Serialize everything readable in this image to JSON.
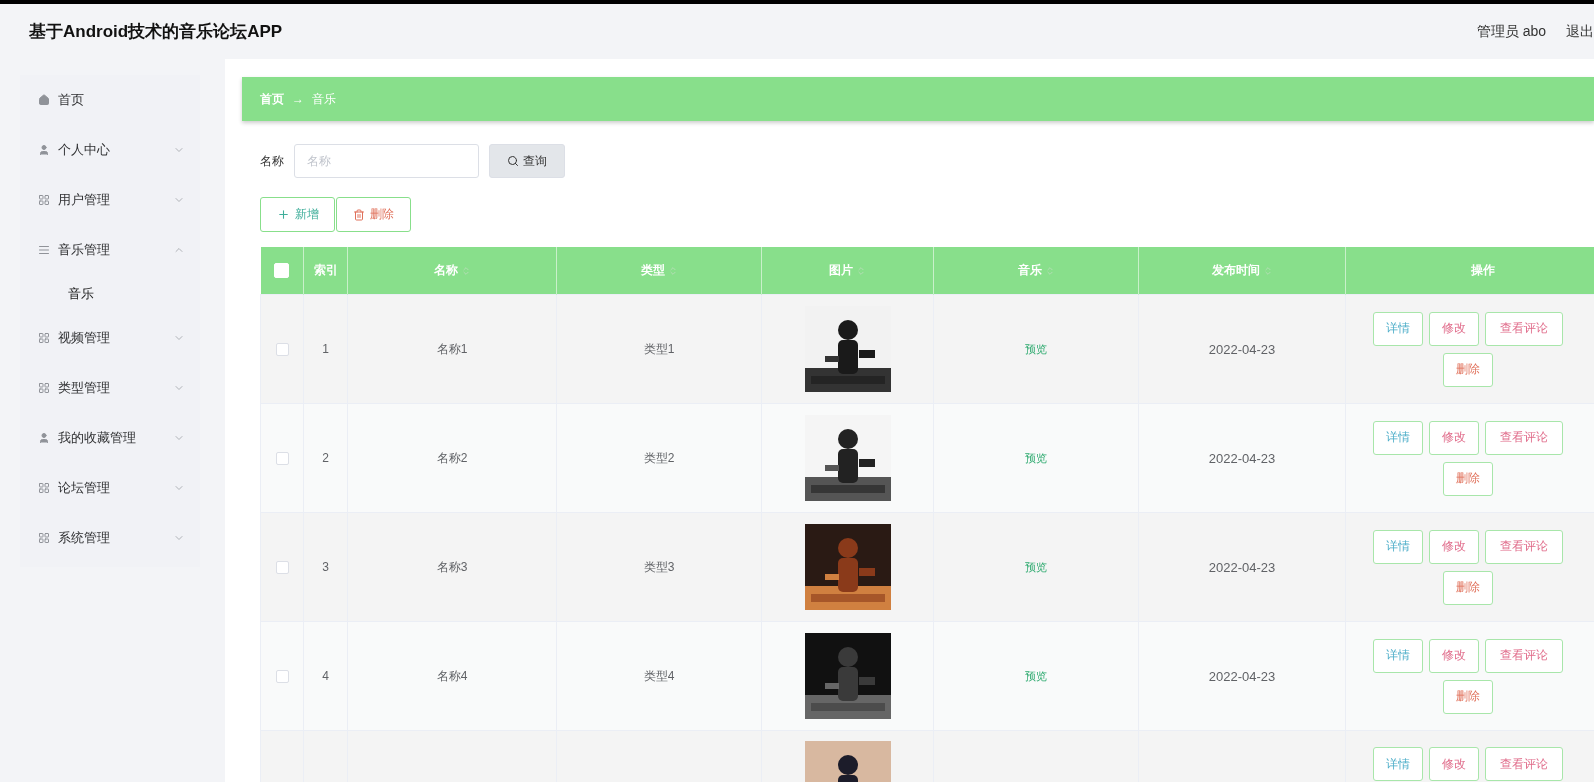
{
  "header": {
    "title": "基于Android技术的音乐论坛APP",
    "user": "管理员 abo",
    "logout": "退出"
  },
  "sidebar": {
    "items": [
      {
        "label": "首页",
        "expandable": false
      },
      {
        "label": "个人中心",
        "expandable": true,
        "expanded": false
      },
      {
        "label": "用户管理",
        "expandable": true,
        "expanded": false
      },
      {
        "label": "音乐管理",
        "expandable": true,
        "expanded": true,
        "children": [
          {
            "label": "音乐",
            "selected": true
          }
        ]
      },
      {
        "label": "视频管理",
        "expandable": true,
        "expanded": false
      },
      {
        "label": "类型管理",
        "expandable": true,
        "expanded": false
      },
      {
        "label": "我的收藏管理",
        "expandable": true,
        "expanded": false
      },
      {
        "label": "论坛管理",
        "expandable": true,
        "expanded": false
      },
      {
        "label": "系统管理",
        "expandable": true,
        "expanded": false
      }
    ]
  },
  "breadcrumb": [
    "首页",
    "→",
    "音乐"
  ],
  "search": {
    "label": "名称",
    "placeholder": "名称",
    "button": "查询"
  },
  "actions": {
    "add": "新增",
    "delete": "删除"
  },
  "table": {
    "select_all_checked": false,
    "columns": [
      {
        "label": "索引",
        "sortable": false
      },
      {
        "label": "名称",
        "sortable": true
      },
      {
        "label": "类型",
        "sortable": true
      },
      {
        "label": "图片",
        "sortable": true
      },
      {
        "label": "音乐",
        "sortable": true
      },
      {
        "label": "发布时间",
        "sortable": true
      },
      {
        "label": "操作",
        "sortable": false
      }
    ],
    "rows": [
      {
        "checked": false,
        "index": "1",
        "name": "名称1",
        "type": "类型1",
        "picture": {
          "kind": "picture"
        },
        "music": "预览",
        "date": "2022-04-23",
        "buttons": [
          "详情",
          "修改",
          "查看评论",
          "删除"
        ]
      },
      {
        "checked": false,
        "index": "2",
        "name": "名称2",
        "type": "类型2",
        "picture": {
          "kind": "picture"
        },
        "music": "预览",
        "date": "2022-04-23",
        "buttons": [
          "详情",
          "修改",
          "查看评论",
          "删除"
        ]
      },
      {
        "checked": false,
        "index": "3",
        "name": "名称3",
        "type": "类型3",
        "picture": {
          "kind": "picture"
        },
        "music": "预览",
        "date": "2022-04-23",
        "buttons": [
          "详情",
          "修改",
          "查看评论",
          "删除"
        ]
      },
      {
        "checked": false,
        "index": "4",
        "name": "名称4",
        "type": "类型4",
        "picture": {
          "kind": "picture"
        },
        "music": "预览",
        "date": "2022-04-23",
        "buttons": [
          "详情",
          "修改",
          "查看评论",
          "删除"
        ]
      },
      {
        "picture": {
          "kind": "picture"
        },
        "buttons": [
          "详情",
          "修改",
          "查看评论"
        ]
      }
    ]
  }
}
